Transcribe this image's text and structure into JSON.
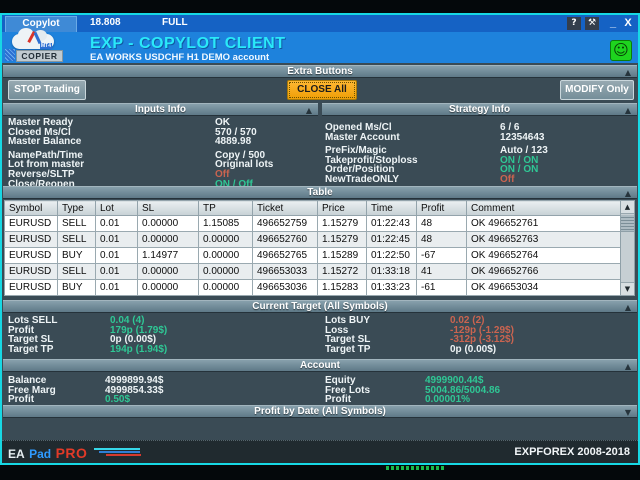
{
  "colors": {
    "accent_cyan": "#17d8e4",
    "title_blue": "#1562c4",
    "header_blue": "#1e82dc",
    "green": "#2fc795",
    "red": "#ca6450",
    "amber": "#f0a718",
    "slate": "#3a4b55"
  },
  "titlebar": {
    "tab": "Copylot",
    "version": "18.808",
    "license": "FULL",
    "help_icon": "?",
    "tools_icon": "⚒",
    "minimize_icon": "_",
    "close_icon": "X"
  },
  "header": {
    "title": "EXP - COPYLOT CLIENT",
    "subtitle": "EA WORKS USDCHF  H1 DEMO account",
    "logo_label": "COPIER",
    "logo_badge": "MT4",
    "smiley_icon": "☺"
  },
  "sections": {
    "extra_buttons": {
      "title": "Extra Buttons",
      "collapse_icon": "▲",
      "buttons": {
        "stop": "STOP Trading",
        "close_all": "CLOSE All",
        "modify": "MODIFY Only"
      }
    },
    "inputs_info": {
      "title": "Inputs Info",
      "collapse_icon": "▲",
      "rows": [
        {
          "label": "Master Ready",
          "value": "OK",
          "tone": "white"
        },
        {
          "label": "Closed Ms/Cl",
          "value": "570 / 570",
          "tone": "white"
        },
        {
          "label": "Master Balance",
          "value": "4889.98",
          "tone": "white"
        },
        {
          "label": "NamePath/Time",
          "value": "Copy / 500",
          "tone": "white"
        },
        {
          "label": "Lot from master",
          "value": "Original lots",
          "tone": "white"
        },
        {
          "label": "Reverse/SLTP",
          "value": "Off",
          "tone": "red"
        },
        {
          "label": "Close/Reopen",
          "value": "ON / Off",
          "tone": "green"
        }
      ]
    },
    "strategy_info": {
      "title": "Strategy Info",
      "collapse_icon": "▲",
      "rows": [
        {
          "label": "Opened Ms/Cl",
          "value": "6 / 6",
          "tone": "white"
        },
        {
          "label": "Master Account",
          "value": "12354643",
          "tone": "white"
        },
        {
          "label": "PreFix/Magic",
          "value": "Auto / 123",
          "tone": "white"
        },
        {
          "label": "Takeprofit/Stoploss",
          "value": "ON / ON",
          "tone": "green"
        },
        {
          "label": "Order/Position",
          "value": "ON / ON",
          "tone": "green"
        },
        {
          "label": "NewTradeONLY",
          "value": "Off",
          "tone": "red"
        }
      ]
    },
    "table": {
      "title": "Table",
      "collapse_icon": "▲",
      "scroll_up_icon": "▲",
      "scroll_down_icon": "▼",
      "columns": [
        "Symbol",
        "Type",
        "Lot",
        "SL",
        "TP",
        "Ticket",
        "Price",
        "Time",
        "Profit",
        "Comment"
      ],
      "rows": [
        [
          "EURUSD",
          "SELL",
          "0.01",
          "0.00000",
          "1.15085",
          "496652759",
          "1.15279",
          "01:22:43",
          "48",
          "OK 496652761"
        ],
        [
          "EURUSD",
          "SELL",
          "0.01",
          "0.00000",
          "0.00000",
          "496652760",
          "1.15279",
          "01:22:45",
          "48",
          "OK 496652763"
        ],
        [
          "EURUSD",
          "BUY",
          "0.01",
          "1.14977",
          "0.00000",
          "496652765",
          "1.15289",
          "01:22:50",
          "-67",
          "OK 496652764"
        ],
        [
          "EURUSD",
          "SELL",
          "0.01",
          "0.00000",
          "0.00000",
          "496653033",
          "1.15272",
          "01:33:18",
          "41",
          "OK 496652766"
        ],
        [
          "EURUSD",
          "BUY",
          "0.01",
          "0.00000",
          "0.00000",
          "496653036",
          "1.15283",
          "01:33:23",
          "-61",
          "OK 496653034"
        ]
      ]
    },
    "current_target": {
      "title": "Current Target (All Symbols)",
      "collapse_icon": "▲",
      "left": [
        {
          "label": "Lots SELL",
          "value": "0.04 (4)",
          "tone": "green"
        },
        {
          "label": "Profit",
          "value": "179p (1.79$)",
          "tone": "green"
        },
        {
          "label": "Target SL",
          "value": "0p (0.00$)",
          "tone": "white"
        },
        {
          "label": "Target TP",
          "value": "194p (1.94$)",
          "tone": "green"
        }
      ],
      "right": [
        {
          "label": "Lots BUY",
          "value": "0.02 (2)",
          "tone": "red"
        },
        {
          "label": "Loss",
          "value": "-129p (-1.29$)",
          "tone": "red"
        },
        {
          "label": "Target SL",
          "value": "-312p (-3.12$)",
          "tone": "red"
        },
        {
          "label": "Target TP",
          "value": "0p (0.00$)",
          "tone": "white"
        }
      ]
    },
    "account": {
      "title": "Account",
      "collapse_icon": "▲",
      "left": [
        {
          "label": "Balance",
          "value": "4999899.94$",
          "tone": "white"
        },
        {
          "label": "Free Marg",
          "value": "4999854.33$",
          "tone": "white"
        },
        {
          "label": "Profit",
          "value": "0.50$",
          "tone": "green"
        }
      ],
      "right": [
        {
          "label": "Equity",
          "value": "4999900.44$",
          "tone": "green"
        },
        {
          "label": "Free Lots",
          "value": "5004.86/5004.86",
          "tone": "green"
        },
        {
          "label": "Profit",
          "value": "0.00001%",
          "tone": "green"
        }
      ]
    },
    "profit_by_date": {
      "title": "Profit by Date (All Symbols)",
      "collapse_icon": "▼"
    }
  },
  "footer": {
    "brand_ea": "EA",
    "brand_pad": "Pad",
    "brand_pro": "PRO",
    "copyright": "EXPFOREX 2008-2018"
  }
}
